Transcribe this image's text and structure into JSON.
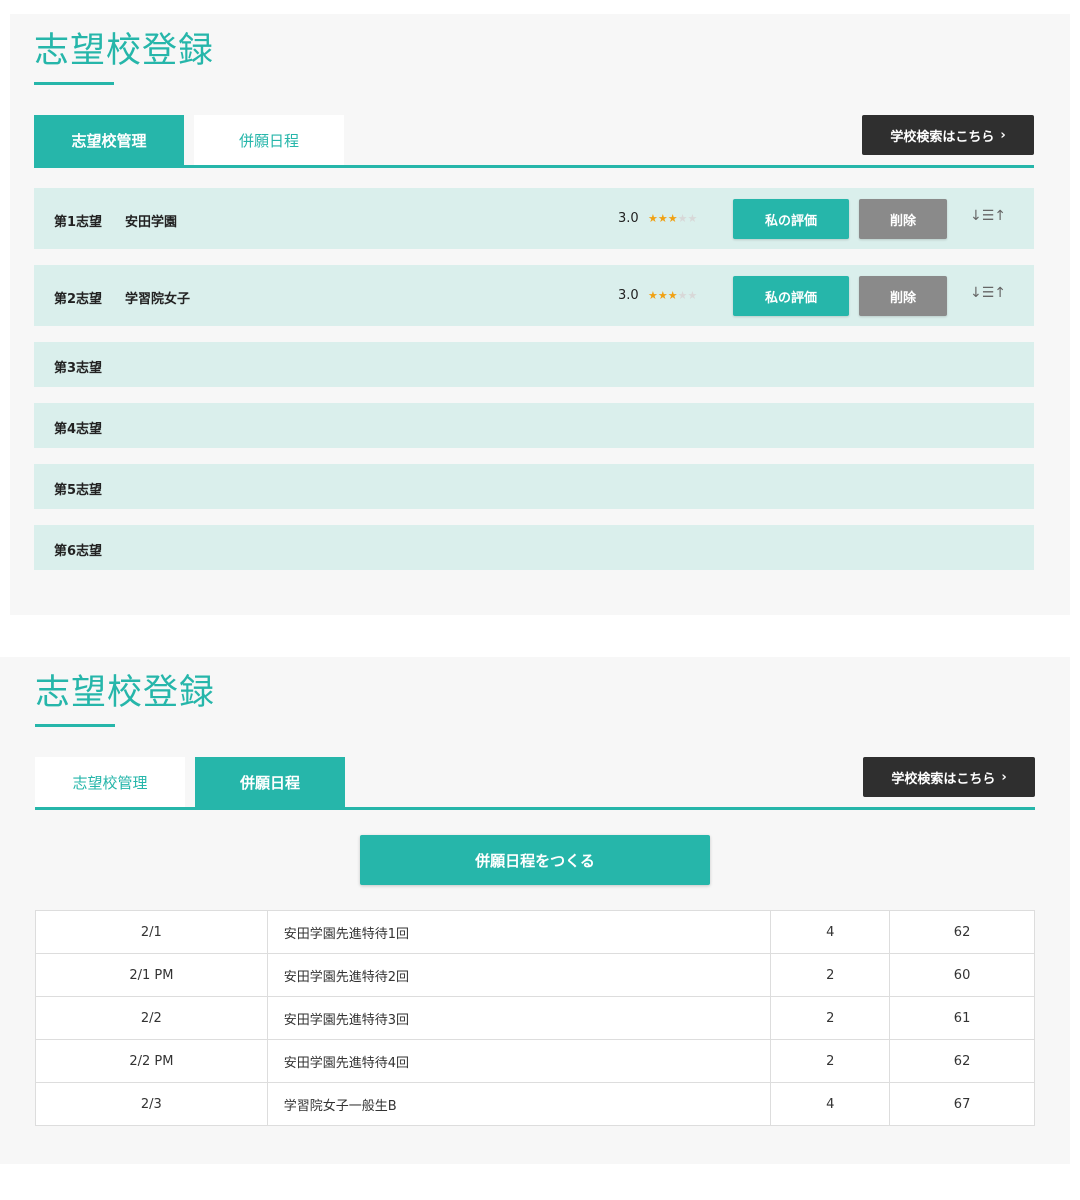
{
  "section1": {
    "title": "志望校登録",
    "tabs": [
      {
        "label": "志望校管理",
        "active": true
      },
      {
        "label": "併願日程",
        "active": false
      }
    ],
    "search_button": "学校検索はこちら",
    "choices": [
      {
        "rank": "第1志望",
        "school": "安田学園",
        "score": "3.0",
        "stars": 3,
        "max_stars": 5,
        "eval_label": "私の評価",
        "delete_label": "削除"
      },
      {
        "rank": "第2志望",
        "school": "学習院女子",
        "score": "3.0",
        "stars": 3,
        "max_stars": 5,
        "eval_label": "私の評価",
        "delete_label": "削除"
      },
      {
        "rank": "第3志望"
      },
      {
        "rank": "第4志望"
      },
      {
        "rank": "第5志望"
      },
      {
        "rank": "第6志望"
      }
    ]
  },
  "section2": {
    "title": "志望校登録",
    "tabs": [
      {
        "label": "志望校管理",
        "active": false
      },
      {
        "label": "併願日程",
        "active": true
      }
    ],
    "search_button": "学校検索はこちら",
    "create_button": "併願日程をつくる",
    "schedule": [
      {
        "date": "2/1",
        "exam": "安田学園先進特待1回",
        "count": "4",
        "deviation": "62"
      },
      {
        "date": "2/1 PM",
        "exam": "安田学園先進特待2回",
        "count": "2",
        "deviation": "60"
      },
      {
        "date": "2/2",
        "exam": "安田学園先進特待3回",
        "count": "2",
        "deviation": "61"
      },
      {
        "date": "2/2 PM",
        "exam": "安田学園先進特待4回",
        "count": "2",
        "deviation": "62"
      },
      {
        "date": "2/3",
        "exam": "学習院女子一般生B",
        "count": "4",
        "deviation": "67"
      }
    ]
  },
  "colors": {
    "accent": "#26b6aa",
    "row_bg": "#daefec",
    "star": "#f0a114",
    "dark_button": "#2f2f2f",
    "delete_button": "#8a8a8a"
  },
  "icons": {
    "chevron": "chevron-right-icon",
    "sort": "sort-icon",
    "star": "star-icon"
  }
}
